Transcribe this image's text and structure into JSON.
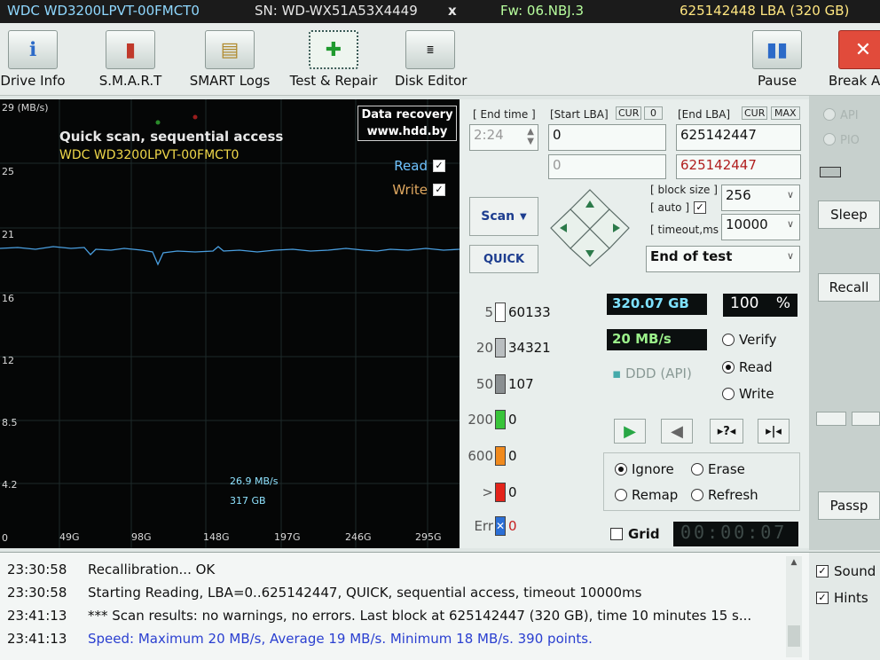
{
  "topbar": {
    "model": "WDC WD3200LPVT-00FMCT0",
    "serial": "SN: WD-WX51A53X4449",
    "close": "x",
    "firmware": "Fw: 06.NBJ.3",
    "capacity": "625142448 LBA (320 GB)"
  },
  "toolbar": [
    {
      "label": "Drive Info",
      "icon": "drive-info-icon",
      "glyph": "ℹ"
    },
    {
      "label": "S.M.A.R.T",
      "icon": "smart-icon",
      "glyph": "▮"
    },
    {
      "label": "SMART Logs",
      "icon": "smart-logs-icon",
      "glyph": "📁"
    },
    {
      "label": "Test & Repair",
      "icon": "test-repair-icon",
      "glyph": "✚"
    },
    {
      "label": "Disk Editor",
      "icon": "disk-editor-icon",
      "glyph": "≣"
    },
    {
      "label": "Pause",
      "icon": "pause-icon",
      "glyph": "⏸"
    },
    {
      "label": "Break All",
      "icon": "break-all-icon",
      "glyph": "✕"
    }
  ],
  "graph": {
    "y_unit": "29 (MB/s)",
    "y_ticks": [
      "25",
      "21",
      "16",
      "12",
      "8.5",
      "4.2",
      "0"
    ],
    "x_ticks": [
      "49G",
      "98G",
      "148G",
      "197G",
      "246G",
      "295G"
    ],
    "title": "Quick scan, sequential access",
    "subtitle": "WDC WD3200LPVT-00FMCT0",
    "recovery_line1": "Data recovery",
    "recovery_line2": "www.hdd.by",
    "legend_read": "Read",
    "legend_write": "Write",
    "current_speed": "26.9 MB/s",
    "current_pos": "317 GB",
    "line_color": "#4a9fe0"
  },
  "controls": {
    "end_time_label": "[ End time ]",
    "end_time_value": "2:24",
    "start_lba_label": "[Start LBA]",
    "cur_label": "CUR",
    "cur_value": "0",
    "start_lba_value": "0",
    "start_lba_value2": "0",
    "end_lba_label": "[End LBA]",
    "max_label": "MAX",
    "end_lba_value": "625142447",
    "end_lba_value2": "625142447",
    "scan_button": "Scan",
    "quick_button": "QUICK",
    "block_size_label": "[ block size ]",
    "auto_label": "[ auto ]",
    "timeout_label": "[ timeout,ms ]",
    "block_size_value": "256",
    "timeout_value": "10000",
    "end_action": "End of test"
  },
  "blocks": [
    {
      "ms": "5",
      "count": "60133",
      "color": "#ffffff"
    },
    {
      "ms": "20",
      "count": "34321",
      "color": "#b9bec0"
    },
    {
      "ms": "50",
      "count": "107",
      "color": "#8a8f91"
    },
    {
      "ms": "200",
      "count": "0",
      "color": "#39c43a"
    },
    {
      "ms": "600",
      "count": "0",
      "color": "#f08a1e"
    },
    {
      "ms": ">",
      "count": "0",
      "color": "#e3241b"
    },
    {
      "ms": "Err",
      "count": "0",
      "color": "#2b6fd6"
    }
  ],
  "status": {
    "capacity_done": "320.07 GB",
    "percent": "100",
    "percent_sign": "%",
    "speed": "20 MB/s",
    "ddd": "DDD (API)",
    "mode_verify": "Verify",
    "mode_read": "Read",
    "mode_write": "Write",
    "ignore": "Ignore",
    "erase": "Erase",
    "remap": "Remap",
    "refresh": "Refresh",
    "grid": "Grid",
    "timer": "00:00:07"
  },
  "right": {
    "api": "API",
    "pio": "PIO",
    "sleep": "Sleep",
    "recall": "Recall",
    "passp": "Passp"
  },
  "log": [
    {
      "time": "23:30:58",
      "text": "Recallibration... OK",
      "color": "#111111"
    },
    {
      "time": "23:30:58",
      "text": "Starting Reading, LBA=0..625142447, QUICK, sequential access, timeout 10000ms",
      "color": "#111111"
    },
    {
      "time": "23:41:13",
      "text": "*** Scan results: no warnings, no errors. Last block at 625142447 (320 GB), time 10 minutes 15 s...",
      "color": "#111111"
    },
    {
      "time": "23:41:13",
      "text": "Speed: Maximum 20 MB/s, Average 19 MB/s. Minimum 18 MB/s. 390 points.",
      "color": "#2a3fd0"
    }
  ],
  "options": {
    "sound": "Sound",
    "hints": "Hints"
  }
}
